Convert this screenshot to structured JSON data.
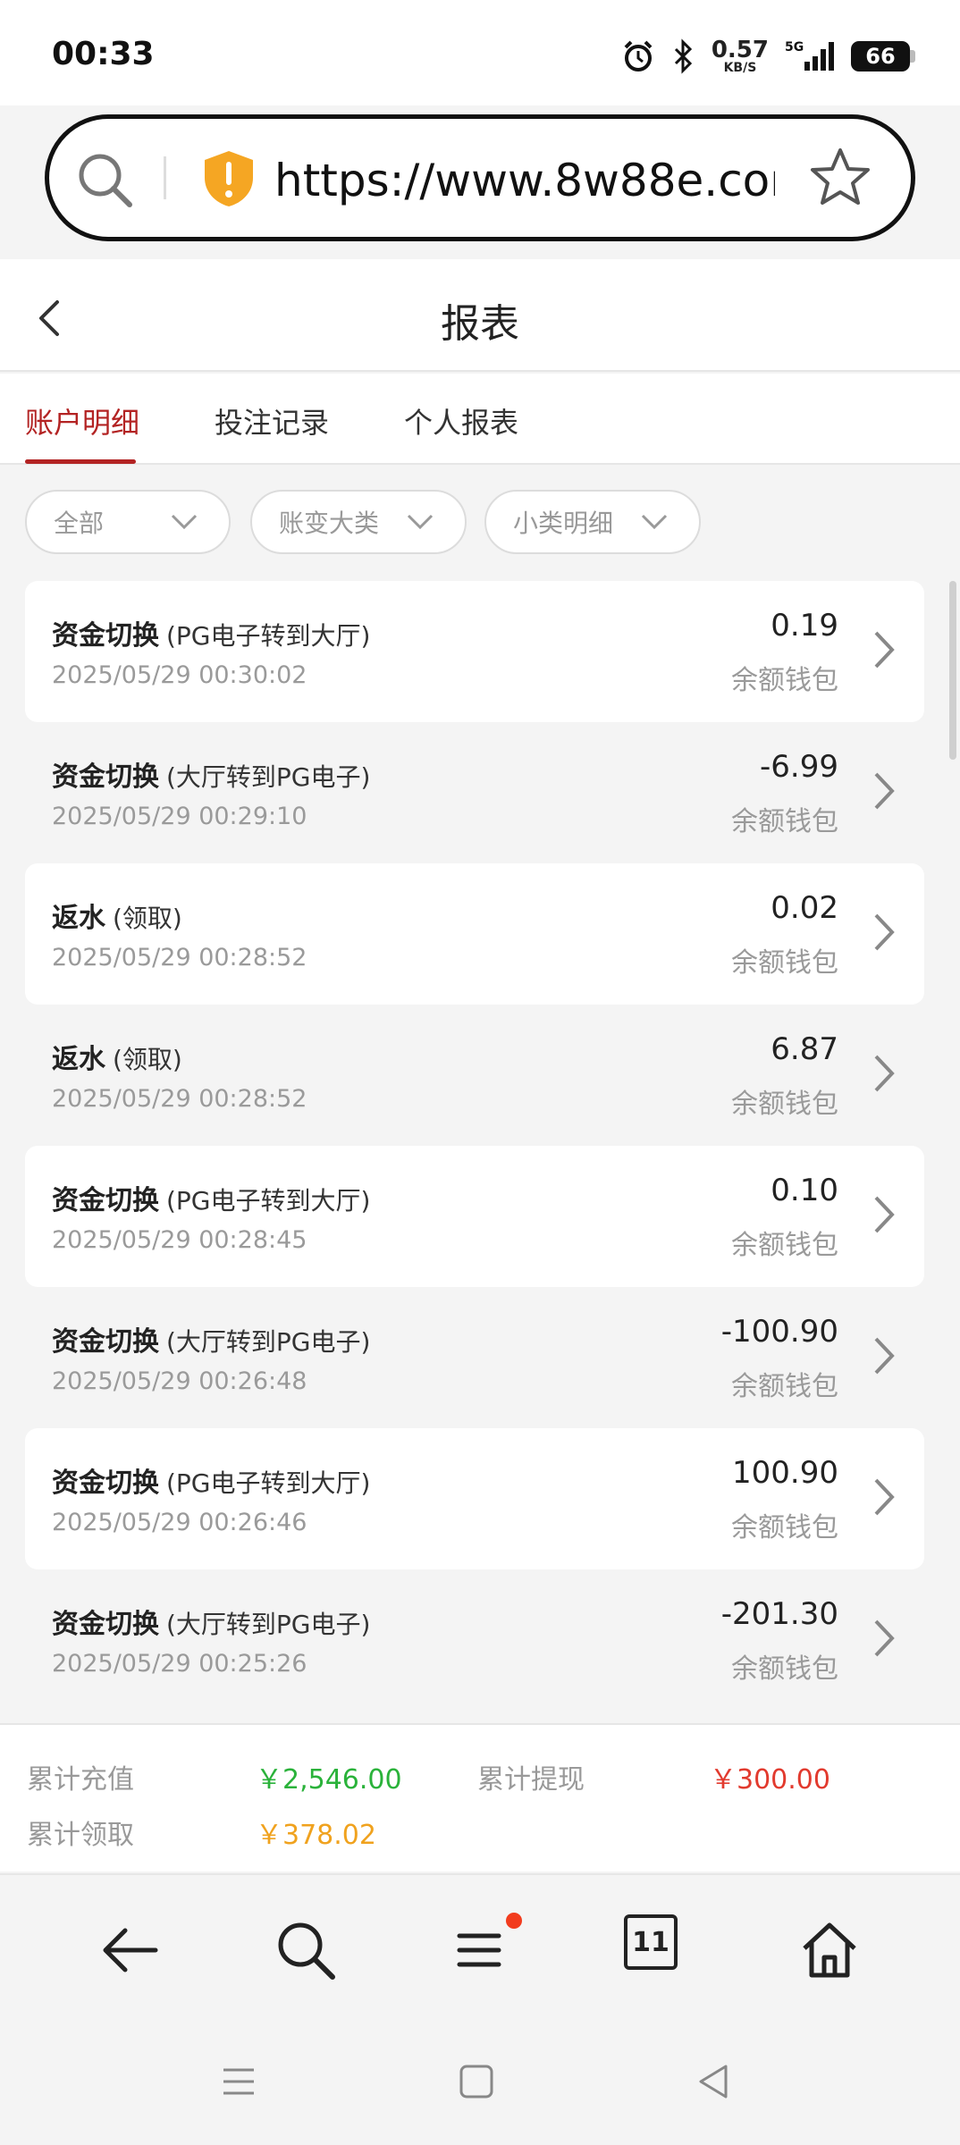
{
  "status": {
    "time": "00:33",
    "net_speed_value": "0.57",
    "net_speed_unit": "KB/S",
    "battery": "66"
  },
  "browser": {
    "url": "https://www.8w88e.com...",
    "tab_count": "11"
  },
  "header": {
    "title": "报表"
  },
  "tabs": [
    {
      "label": "账户明细"
    },
    {
      "label": "投注记录"
    },
    {
      "label": "个人报表"
    }
  ],
  "filters": [
    {
      "label": "全部"
    },
    {
      "label": "账变大类"
    },
    {
      "label": "小类明细"
    }
  ],
  "records": [
    {
      "title": "资金切换",
      "sub": "(PG电子转到大厅)",
      "date": "2025/05/29 00:30:02",
      "amount": "0.19",
      "wallet": "余额钱包"
    },
    {
      "title": "资金切换",
      "sub": "(大厅转到PG电子)",
      "date": "2025/05/29 00:29:10",
      "amount": "-6.99",
      "wallet": "余额钱包"
    },
    {
      "title": "返水",
      "sub": "(领取)",
      "date": "2025/05/29 00:28:52",
      "amount": "0.02",
      "wallet": "余额钱包"
    },
    {
      "title": "返水",
      "sub": "(领取)",
      "date": "2025/05/29 00:28:52",
      "amount": "6.87",
      "wallet": "余额钱包"
    },
    {
      "title": "资金切换",
      "sub": "(PG电子转到大厅)",
      "date": "2025/05/29 00:28:45",
      "amount": "0.10",
      "wallet": "余额钱包"
    },
    {
      "title": "资金切换",
      "sub": "(大厅转到PG电子)",
      "date": "2025/05/29 00:26:48",
      "amount": "-100.90",
      "wallet": "余额钱包"
    },
    {
      "title": "资金切换",
      "sub": "(PG电子转到大厅)",
      "date": "2025/05/29 00:26:46",
      "amount": "100.90",
      "wallet": "余额钱包"
    },
    {
      "title": "资金切换",
      "sub": "(大厅转到PG电子)",
      "date": "2025/05/29 00:25:26",
      "amount": "-201.30",
      "wallet": "余额钱包"
    }
  ],
  "summary": {
    "deposit_label": "累计充值",
    "deposit_value": "￥2,546.00",
    "withdraw_label": "累计提现",
    "withdraw_value": "￥300.00",
    "claim_label": "累计领取",
    "claim_value": "￥378.02"
  },
  "colors": {
    "accent": "#b32323",
    "deposit": "#2ab23a",
    "withdraw": "#e23a2e",
    "claim": "#f0a21e"
  }
}
